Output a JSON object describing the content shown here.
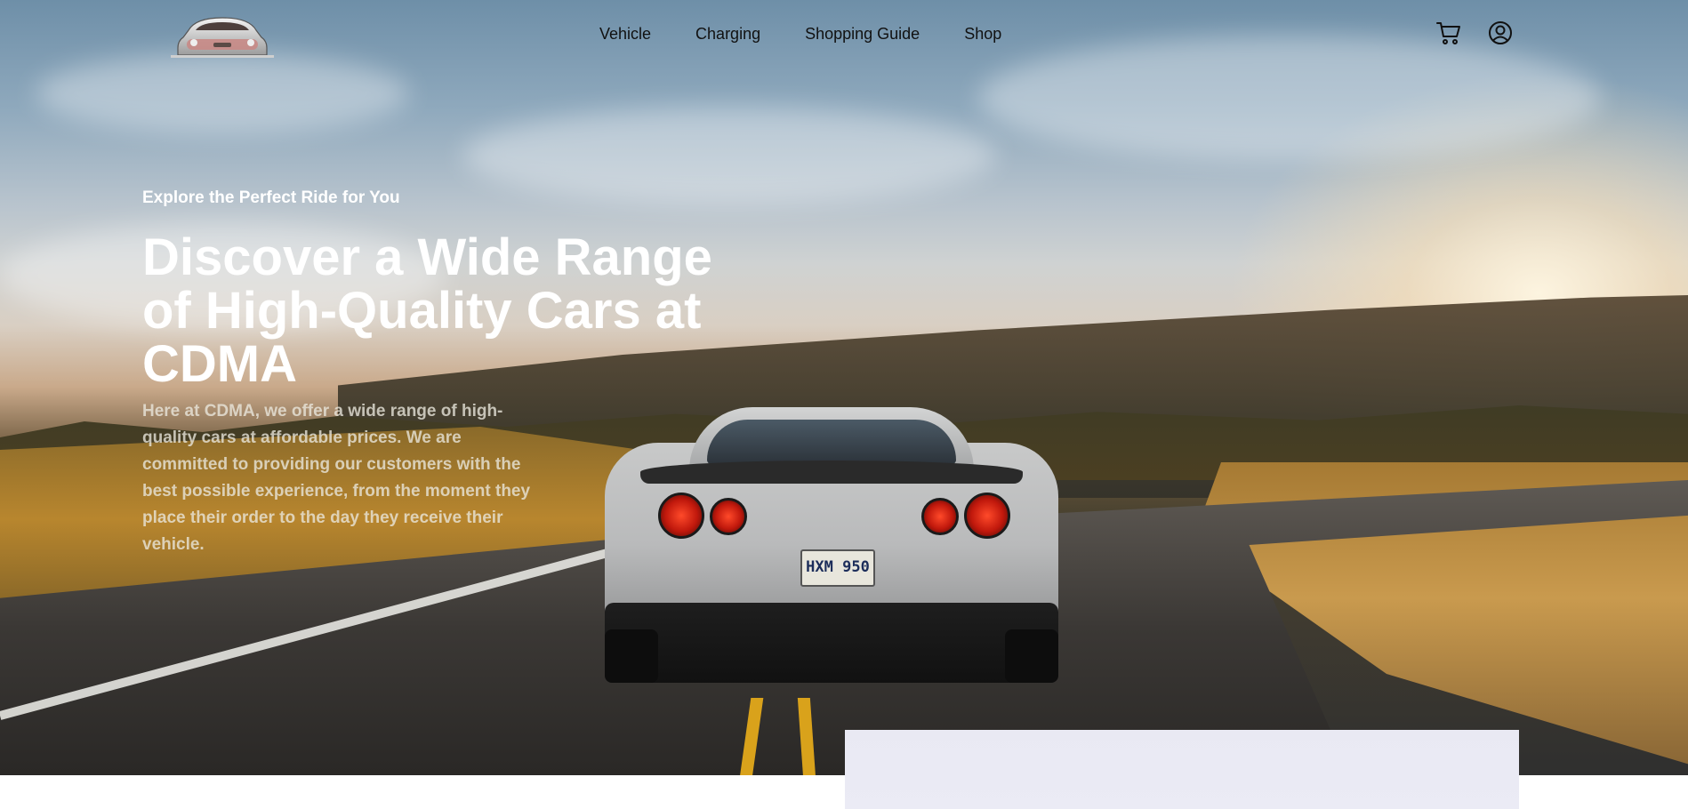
{
  "brand": {
    "logo_icon": "sports-car-logo-icon"
  },
  "nav": {
    "links": [
      {
        "label": "Vehicle"
      },
      {
        "label": "Charging"
      },
      {
        "label": "Shopping Guide"
      },
      {
        "label": "Shop"
      }
    ],
    "icons": {
      "cart": "shopping-cart-icon",
      "account": "user-account-icon"
    }
  },
  "hero": {
    "eyebrow": "Explore the Perfect Ride for You",
    "headline": "Discover a Wide Range of High-Quality Cars at CDMA",
    "body": "Here at CDMA, we offer a wide range of high-quality cars at affordable prices. We are committed to providing our customers with the best possible experience, from the moment they place their order to the day they receive their vehicle.",
    "plate_text": "HXM 950"
  },
  "colors": {
    "nav_text": "#111111",
    "hero_text": "#ffffff",
    "card_bg": "#ebebf5"
  }
}
